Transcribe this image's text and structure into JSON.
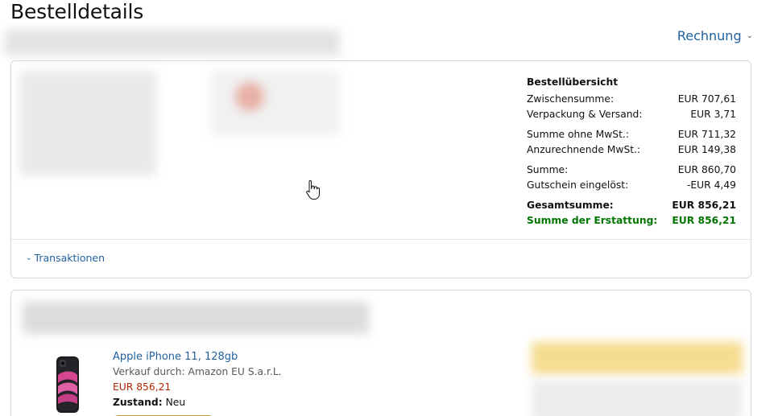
{
  "page": {
    "title": "Bestelldetails"
  },
  "header": {
    "invoice_label": "Rechnung"
  },
  "summary": {
    "heading": "Bestellübersicht",
    "rows": [
      {
        "label": "Zwischensumme:",
        "value": "EUR 707,61"
      },
      {
        "label": "Verpackung & Versand:",
        "value": "EUR 3,71"
      },
      {
        "label": "Summe ohne MwSt.:",
        "value": "EUR 711,32"
      },
      {
        "label": "Anzurechnende MwSt.:",
        "value": "EUR 149,38"
      },
      {
        "label": "Summe:",
        "value": "EUR 860,70"
      },
      {
        "label": "Gutschein eingelöst:",
        "value": "-EUR 4,49"
      },
      {
        "label": "Gesamtsumme:",
        "value": "EUR 856,21"
      },
      {
        "label": "Summe der Erstattung:",
        "value": "EUR 856,21"
      }
    ]
  },
  "transactions": {
    "label": "Transaktionen"
  },
  "product": {
    "name": "Apple iPhone 11, 128gb",
    "seller": "Verkauf durch: Amazon EU S.a.r.L.",
    "price": "EUR 856,21",
    "condition_label": "Zustand:",
    "condition_value": "Neu"
  },
  "colors": {
    "link": "#2162a1",
    "price": "#b12704",
    "refund_green": "#007600",
    "border": "#d5d9d9"
  }
}
